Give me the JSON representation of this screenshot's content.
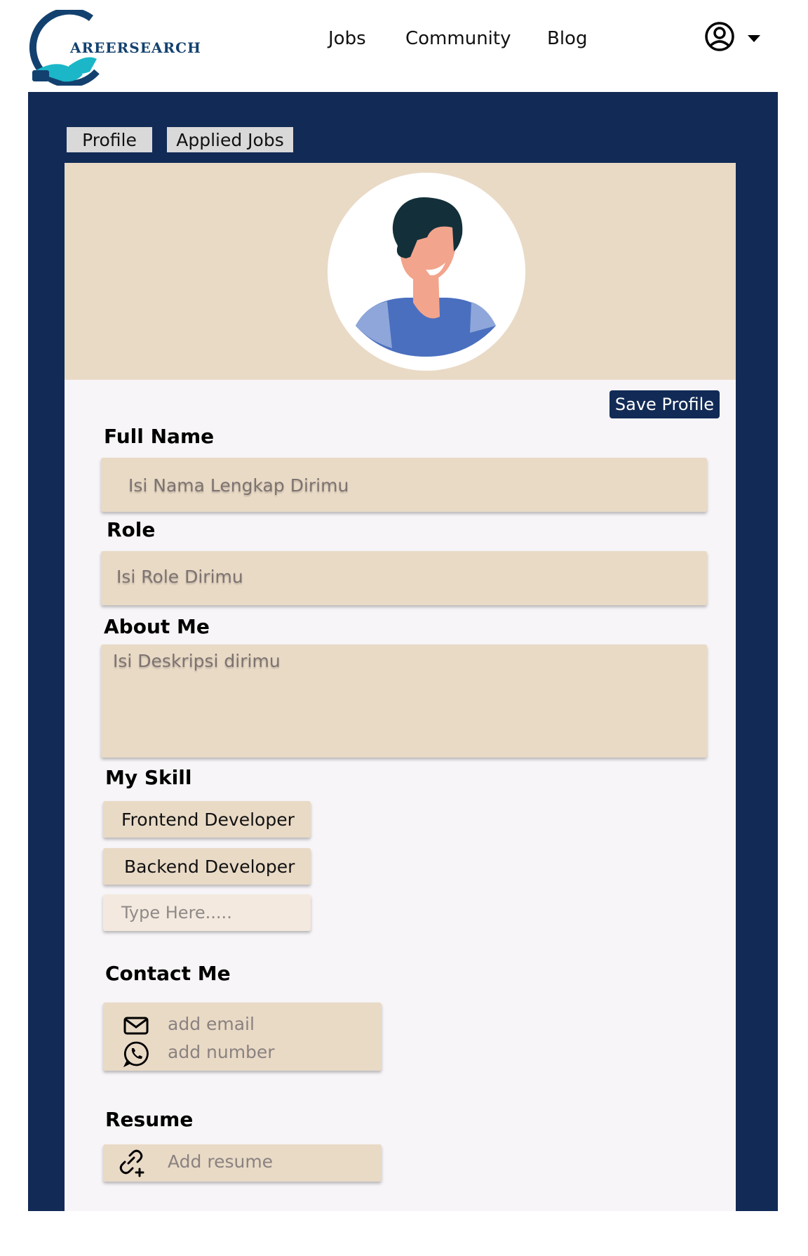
{
  "header": {
    "logo_text": "AREERSEARCH",
    "nav": [
      "Jobs",
      "Community",
      "Blog"
    ],
    "user_icon": "user-circle-icon",
    "caret_icon": "caret-down-icon"
  },
  "tabs": [
    "Profile",
    "Applied Jobs"
  ],
  "profile": {
    "save_label": "Save Profile",
    "full_name": {
      "label": "Full Name",
      "placeholder": "Isi Nama Lengkap Dirimu"
    },
    "role": {
      "label": "Role",
      "placeholder": "Isi Role Dirimu"
    },
    "about": {
      "label": "About Me",
      "placeholder": "Isi Deskripsi dirimu"
    },
    "skills": {
      "label": "My Skill",
      "items": [
        "Frontend Developer",
        "Backend Developer"
      ],
      "input_placeholder": "Type Here....."
    },
    "contact": {
      "label": "Contact Me",
      "email": "add email",
      "number": "add number",
      "email_icon": "mail-icon",
      "number_icon": "whatsapp-icon"
    },
    "resume": {
      "label": "Resume",
      "placeholder": "Add resume",
      "icon": "link-add-icon"
    }
  },
  "colors": {
    "navy": "#122b56",
    "beige": "#e9dac6",
    "card": "#f7f5f7",
    "tab_gray": "#d9d9d9",
    "logo_teal": "#1bb7c8",
    "logo_blue": "#13416f"
  }
}
